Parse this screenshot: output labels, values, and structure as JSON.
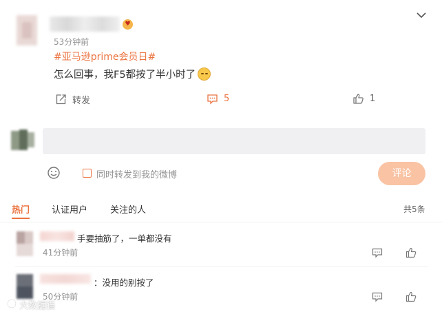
{
  "post": {
    "time": "53分钟前",
    "hashtag": "#亚马逊prime会员日#",
    "body_text": "怎么回事，我F5都按了半小时了",
    "emoji_icon": "smirk-emoji-icon"
  },
  "actions": {
    "repost_label": "转发",
    "comment_count": "5",
    "like_count": "1"
  },
  "composer": {
    "input_value": "",
    "sync_label": "同时转发到我的微博",
    "submit_label": "评论"
  },
  "tabs": {
    "items": [
      "热门",
      "认证用户",
      "关注的人"
    ],
    "total": "共5条"
  },
  "comments": [
    {
      "text": "手要抽筋了，一单都没有",
      "time": "41分钟前"
    },
    {
      "text": "：没用的别按了",
      "time": "50分钟前"
    }
  ],
  "colors": {
    "accent": "#eb7340",
    "submit_bg": "#f9c3a4",
    "input_bg": "#f0f0f3",
    "muted_text": "#939393"
  },
  "watermark": {
    "text": "大数据猫"
  }
}
